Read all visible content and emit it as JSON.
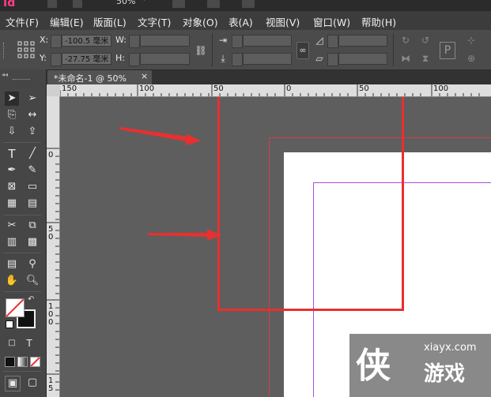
{
  "app": {
    "logo_text": "Id",
    "zoom_label": "50%"
  },
  "menu": [
    "文件(F)",
    "编辑(E)",
    "版面(L)",
    "文字(T)",
    "对象(O)",
    "表(A)",
    "视图(V)",
    "窗口(W)",
    "帮助(H)"
  ],
  "control": {
    "x_label": "X:",
    "x_value": "-100.5 毫米",
    "y_label": "Y:",
    "y_value": "-27.75 毫米",
    "w_label": "W:",
    "h_label": "H:"
  },
  "document": {
    "tab_title": "*未命名-1 @ 50%",
    "close_glyph": "×"
  },
  "ruler": {
    "h_labels": [
      "150",
      "100",
      "50",
      "0",
      "50",
      "100"
    ],
    "v_labels": [
      "0",
      "5\n0",
      "1\n0\n0",
      "1\n5"
    ]
  },
  "watermark": {
    "logo_char": "侠",
    "site": "xiayx.com",
    "name": "游戏"
  },
  "colors": {
    "accent_pink": "#ff3d8a",
    "highlight_red": "#e8302f",
    "bleed_red": "#d2404a",
    "margin_purple": "#b04ad8"
  }
}
